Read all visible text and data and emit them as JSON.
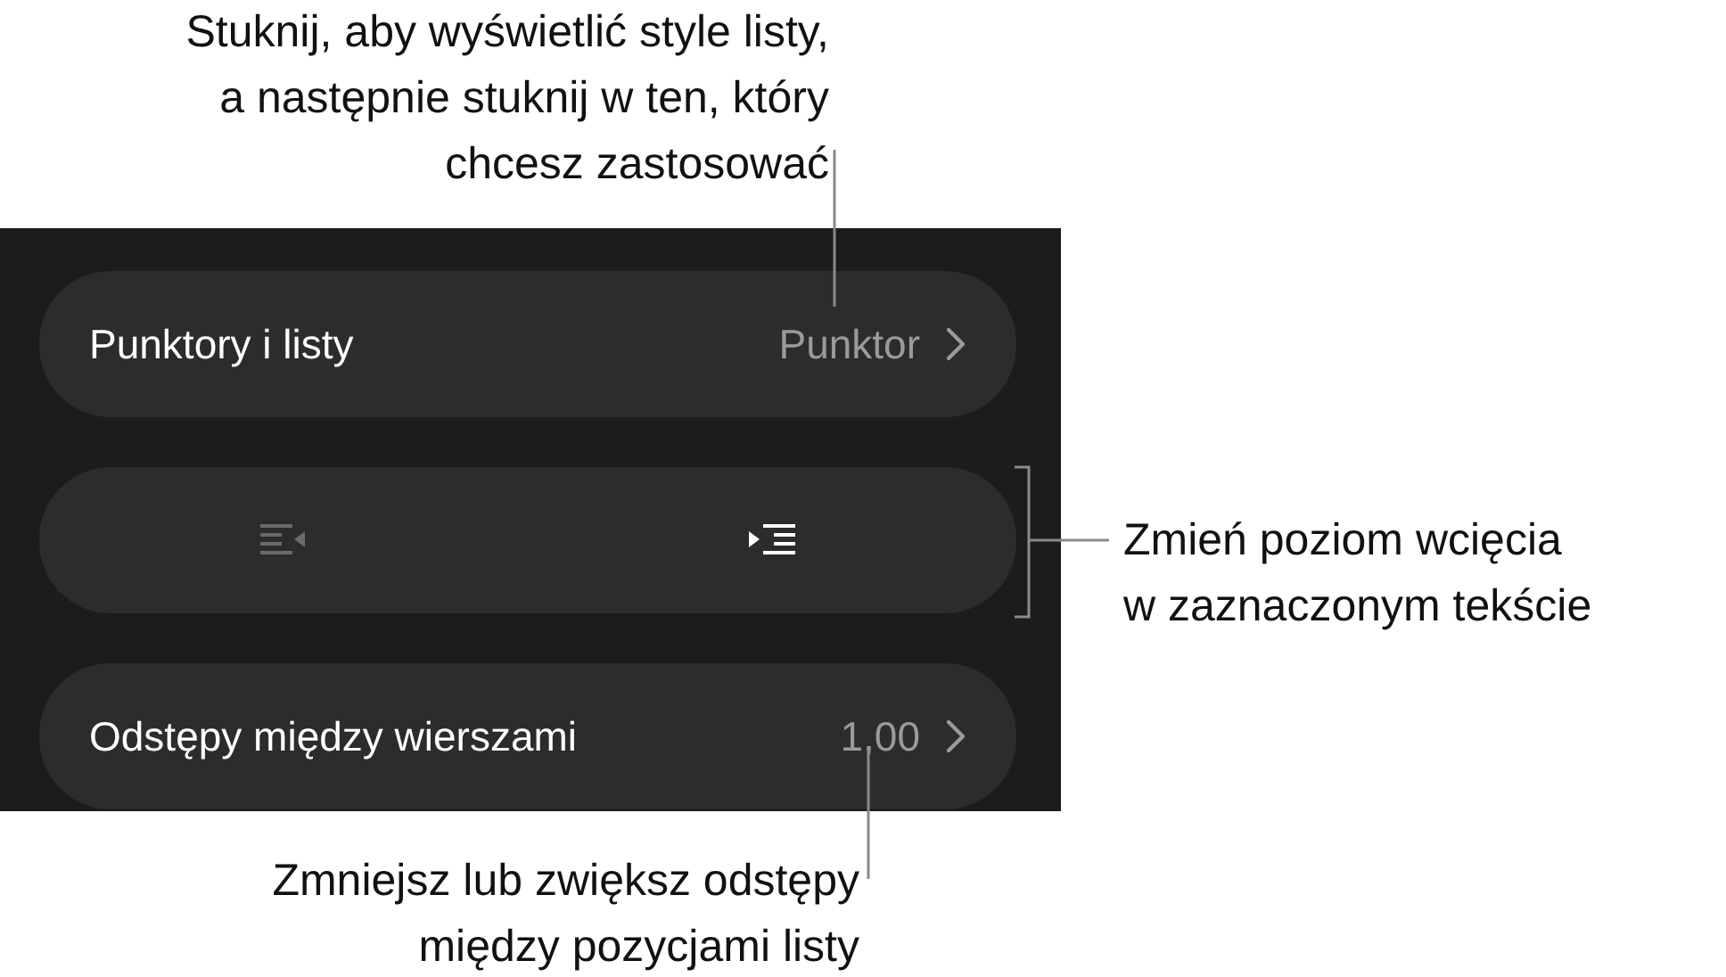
{
  "panel": {
    "rows": [
      {
        "kind": "value",
        "label": "Punktory i listy",
        "value": "Punktor"
      },
      {
        "kind": "indent",
        "buttons": [
          {
            "kind": "outdent",
            "disabled": true
          },
          {
            "kind": "indent",
            "disabled": false
          }
        ]
      },
      {
        "kind": "value",
        "label": "Odstępy między wierszami",
        "value": "1,00"
      }
    ]
  },
  "callouts": [
    {
      "kind": "top",
      "lines": [
        "Stuknij, aby wyświetlić style listy,",
        "a następnie stuknij w ten, który",
        "chcesz zastosować"
      ]
    },
    {
      "kind": "right",
      "lines": [
        "Zmień poziom wcięcia",
        "w zaznaczonym tekście"
      ]
    },
    {
      "kind": "bottom",
      "lines": [
        "Zmniejsz lub zwiększ odstępy",
        "między pozycjami listy"
      ]
    }
  ]
}
